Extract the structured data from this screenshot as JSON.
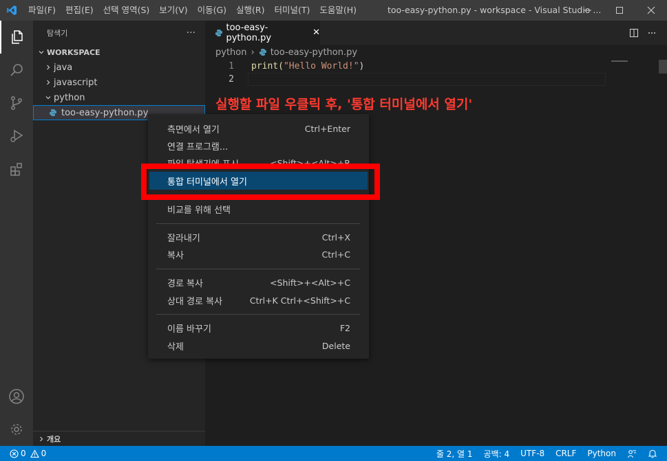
{
  "window": {
    "title": "too-easy-python.py - workspace - Visual Studio ...",
    "menu": [
      "파일(F)",
      "편집(E)",
      "선택 영역(S)",
      "보기(V)",
      "이동(G)",
      "실행(R)",
      "터미널(T)",
      "도움말(H)"
    ]
  },
  "sidebar": {
    "title": "탐색기",
    "more": "···",
    "workspace": "WORKSPACE",
    "items": [
      "java",
      "javascript",
      "python",
      "too-easy-python.py"
    ],
    "outline": "개요"
  },
  "editor": {
    "tab_label": "too-easy-python.py",
    "tab_close": "✕",
    "breadcrumb_folder": "python",
    "breadcrumb_sep": "›",
    "breadcrumb_file": "too-easy-python.py",
    "line_numbers": [
      "1",
      "2"
    ],
    "code_fn": "print(",
    "code_str": "\"Hello World!\"",
    "code_close": ")"
  },
  "annotation": "실행할 파일 우클릭 후, '통합 터미널에서 열기'",
  "context_menu": {
    "items": [
      {
        "label": "측면에서 열기",
        "shortcut": "Ctrl+Enter"
      },
      {
        "label": "연결 프로그램...",
        "shortcut": ""
      },
      {
        "label": "파일 탐색기에 표시",
        "shortcut": "<Shift>+<Alt>+R"
      },
      {
        "label": "통합 터미널에서 열기",
        "shortcut": ""
      },
      {
        "label": "비교를 위해 선택",
        "shortcut": ""
      },
      {
        "label": "잘라내기",
        "shortcut": "Ctrl+X"
      },
      {
        "label": "복사",
        "shortcut": "Ctrl+C"
      },
      {
        "label": "경로 복사",
        "shortcut": "<Shift>+<Alt>+C"
      },
      {
        "label": "상대 경로 복사",
        "shortcut": "Ctrl+K Ctrl+<Shift>+C"
      },
      {
        "label": "이름 바꾸기",
        "shortcut": "F2"
      },
      {
        "label": "삭제",
        "shortcut": "Delete"
      }
    ]
  },
  "status": {
    "errors": "0",
    "warnings": "0",
    "position": "줄 2, 열 1",
    "spaces": "공백: 4",
    "encoding": "UTF-8",
    "eol": "CRLF",
    "language": "Python"
  },
  "colors": {
    "accent": "#007acc",
    "menu_highlight": "#094771",
    "annotation": "#ff3b30",
    "highlight_box": "#ff0000"
  }
}
